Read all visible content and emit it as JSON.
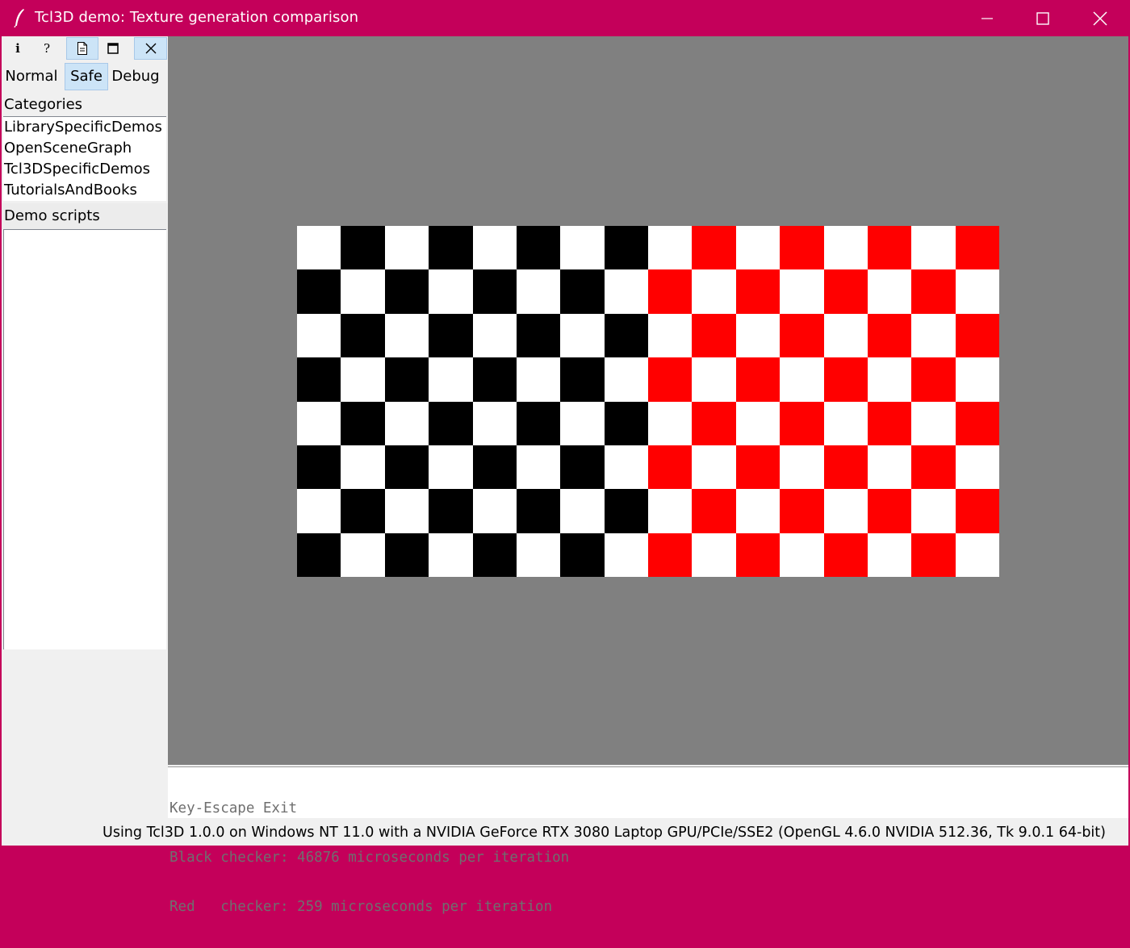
{
  "window": {
    "title": "Tcl3D demo: Texture generation comparison",
    "accent_color": "#c4005a"
  },
  "toolbar": {
    "info_label": "i",
    "help_label": "?",
    "doc_icon": "document-icon",
    "maximize_icon": "square-icon",
    "close_icon": "close-icon"
  },
  "modes": {
    "normal": "Normal",
    "safe": "Safe",
    "debug": "Debug",
    "selected": "Safe"
  },
  "categories": {
    "label": "Categories",
    "items": [
      "LibrarySpecificDemos",
      "OpenSceneGraph",
      "Tcl3DSpecificDemos",
      "TutorialsAndBooks"
    ]
  },
  "demo_scripts": {
    "label": "Demo scripts",
    "items": []
  },
  "viewport": {
    "background": "#808080",
    "checker_rows": 8,
    "checker_cols": 16,
    "left_colors": [
      "#ffffff",
      "#000000"
    ],
    "right_colors": [
      "#ffffff",
      "#ff0000"
    ]
  },
  "console": {
    "lines": [
      "Key-Escape Exit",
      "Black checker: 46876 microseconds per iteration",
      "Red   checker: 259 microseconds per iteration"
    ]
  },
  "status": {
    "text": "Using Tcl3D 1.0.0 on Windows NT 11.0 with a NVIDIA GeForce RTX 3080 Laptop GPU/PCIe/SSE2 (OpenGL 4.6.0 NVIDIA 512.36, Tk 9.0.1 64-bit)"
  }
}
